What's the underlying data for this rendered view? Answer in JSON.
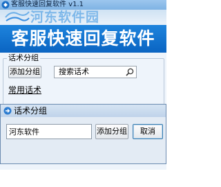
{
  "window": {
    "title": "客服快速回复软件 v1.1"
  },
  "watermark": {
    "text": "河东软件园",
    "logo_icon": "pc6-logo-icon"
  },
  "banner": {
    "text": "客服快速回复软件"
  },
  "group": {
    "label": "话术分组",
    "add_group_label": "添加分组",
    "search": {
      "value": "搜索话术",
      "icon": "search-icon"
    },
    "common_link": "常用话术"
  },
  "dialog": {
    "title": "话术分组",
    "title_icon": "arrow-right-icon",
    "name_value": "河东软件",
    "add_group_label": "添加分组",
    "cancel_label": "取消"
  },
  "colors": {
    "banner": "#1e84dd",
    "window_bg": "#eef4fb",
    "dialog_bg": "#e3ebf4"
  }
}
